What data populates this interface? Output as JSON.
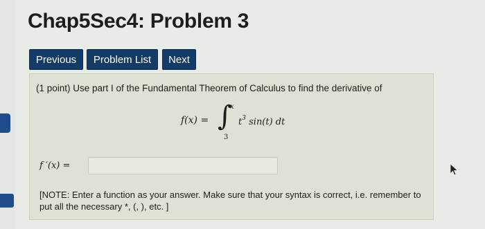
{
  "page": {
    "title": "Chap5Sec4: Problem 3"
  },
  "nav": {
    "previous_label": "Previous",
    "problem_list_label": "Problem List",
    "next_label": "Next"
  },
  "problem": {
    "statement": "(1 point) Use part I of the Fundamental Theorem of Calculus to find the derivative of",
    "equation": {
      "lhs": "f(x) =",
      "integral_symbol": "∫",
      "upper_limit": "x",
      "lower_limit": "3",
      "integrand_base": "t",
      "integrand_exponent": "3",
      "integrand_rest": "sin(t) dt"
    },
    "answer_label": "f ′(x) =",
    "answer_value": "",
    "note": "[NOTE: Enter a function as your answer. Make sure that your syntax is correct, i.e. remember to put all the necessary *, (, ), etc. ]"
  },
  "colors": {
    "button_bg": "#143a66",
    "button_text": "#ffffff",
    "problem_box_bg": "#dde3d4",
    "side_marker": "#1e4d8a"
  }
}
